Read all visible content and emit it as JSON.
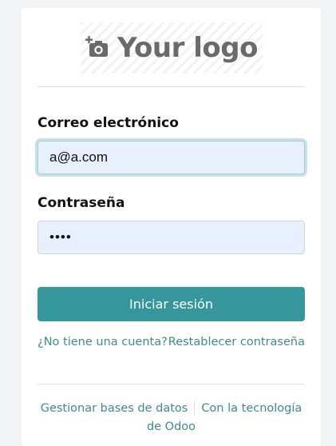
{
  "logo": {
    "text": "Your logo",
    "icon": "camera-plus-icon"
  },
  "form": {
    "email_label": "Correo electrónico",
    "email_value": "a@a.com",
    "password_label": "Contraseña",
    "password_value": "••••",
    "submit_label": "Iniciar sesión"
  },
  "links": {
    "signup": "¿No tiene una cuenta?",
    "reset_password": "Restablecer contraseña"
  },
  "footer": {
    "manage_databases": "Gestionar bases de datos",
    "powered_by": "Con la tecnología de",
    "powered_by_brand": "Odoo"
  },
  "colors": {
    "primary": "#35979c",
    "link": "#3f8a8f",
    "input_bg": "#e8f0fe"
  }
}
